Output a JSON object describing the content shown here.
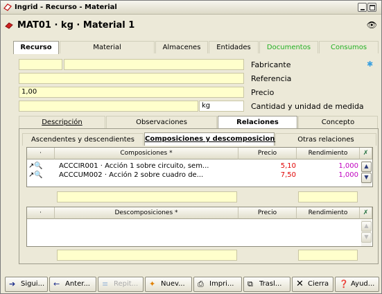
{
  "window": {
    "title": "Ingrid - Recurso - Material"
  },
  "header": {
    "title": "MAT01 · kg · Material 1",
    "search_icon": "binoculars-icon"
  },
  "main_tabs": [
    {
      "label": "Recurso",
      "active": true
    },
    {
      "label": "Material"
    },
    {
      "label": "Almacenes"
    },
    {
      "label": "Entidades"
    },
    {
      "label": "Documentos",
      "color": "#22b022"
    },
    {
      "label": "Consumos",
      "color": "#22b022"
    }
  ],
  "form": {
    "fabricante_label": "Fabricante",
    "referencia_label": "Referencia",
    "precio_label": "Precio",
    "precio_value": "1,00",
    "cantidad_label": "Cantidad y unidad de medida",
    "unidad_value": "kg"
  },
  "sub_tabs": [
    {
      "label": "Descripción"
    },
    {
      "label": "Observaciones"
    },
    {
      "label": "Relaciones",
      "active": true
    },
    {
      "label": "Concepto"
    }
  ],
  "rel_tabs": [
    {
      "label": "Ascendentes y descendientes"
    },
    {
      "label": "Composiciones y descomposiciones",
      "active": true
    },
    {
      "label": "Otras relaciones"
    }
  ],
  "composiciones": {
    "headers": {
      "dot": "·",
      "name": "Composiciones *",
      "precio": "Precio",
      "rendimiento": "Rendimiento"
    },
    "rows": [
      {
        "name": "ACCCIR001 · Acción 1 sobre circuito, sem...",
        "precio": "5,10",
        "rendimiento": "1,000"
      },
      {
        "name": "ACCCUM002 · Acción 2 sobre cuadro de...",
        "precio": "7,50",
        "rendimiento": "1,000"
      }
    ]
  },
  "descomposiciones": {
    "headers": {
      "dot": "·",
      "name": "Descomposiciones *",
      "precio": "Precio",
      "rendimiento": "Rendimiento"
    },
    "rows": []
  },
  "buttons": [
    {
      "label": "Sigui...",
      "icon": "arrow-right-icon"
    },
    {
      "label": "Anter...",
      "icon": "arrow-left-icon"
    },
    {
      "label": "Repit...",
      "icon": "repeat-icon",
      "disabled": true
    },
    {
      "label": "Nuev...",
      "icon": "new-icon"
    },
    {
      "label": "Impri...",
      "icon": "printer-icon"
    },
    {
      "label": "Trasl...",
      "icon": "transfer-icon"
    },
    {
      "label": "Cierra",
      "icon": "close-icon"
    },
    {
      "label": "Ayud...",
      "icon": "help-icon"
    }
  ]
}
